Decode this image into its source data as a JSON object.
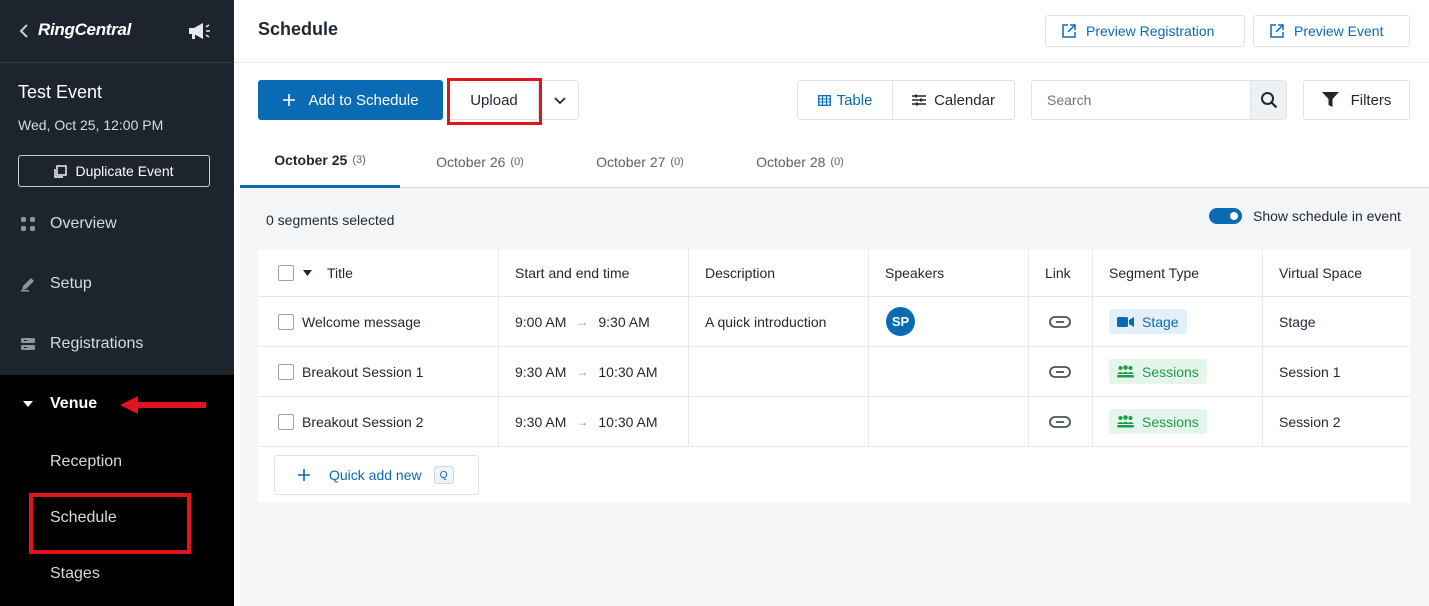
{
  "sidebar": {
    "brand": "RingCentral",
    "event_name": "Test Event",
    "event_date": "Wed, Oct 25, 12:00 PM",
    "duplicate_label": "Duplicate Event",
    "nav": [
      {
        "label": "Overview",
        "icon": "grid-icon"
      },
      {
        "label": "Setup",
        "icon": "pencil-icon"
      },
      {
        "label": "Registrations",
        "icon": "registrations-icon"
      }
    ],
    "venue_label": "Venue",
    "venue_items": [
      "Reception",
      "Schedule",
      "Stages"
    ]
  },
  "header": {
    "title": "Schedule",
    "preview_registration": "Preview Registration",
    "preview_event": "Preview Event"
  },
  "toolbar": {
    "add_label": "Add to Schedule",
    "upload_label": "Upload",
    "view_table": "Table",
    "view_calendar": "Calendar",
    "search_placeholder": "Search",
    "filters_label": "Filters"
  },
  "tabs": [
    {
      "label": "October 25",
      "count": "(3)",
      "active": true
    },
    {
      "label": "October 26",
      "count": "(0)",
      "active": false
    },
    {
      "label": "October 27",
      "count": "(0)",
      "active": false
    },
    {
      "label": "October 28",
      "count": "(0)",
      "active": false
    }
  ],
  "summary": {
    "selected": "0 segments selected",
    "toggle_label": "Show schedule in event",
    "toggle_on": true
  },
  "table": {
    "columns": [
      "Title",
      "Start and end time",
      "Description",
      "Speakers",
      "Link",
      "Segment Type",
      "Virtual Space"
    ],
    "rows": [
      {
        "title": "Welcome message",
        "start": "9:00 AM",
        "end": "9:30 AM",
        "description": "A quick introduction",
        "speaker": "SP",
        "segment_type": "Stage",
        "virtual_space": "Stage"
      },
      {
        "title": "Breakout Session 1",
        "start": "9:30 AM",
        "end": "10:30 AM",
        "description": "",
        "speaker": "",
        "segment_type": "Sessions",
        "virtual_space": "Session 1"
      },
      {
        "title": "Breakout Session 2",
        "start": "9:30 AM",
        "end": "10:30 AM",
        "description": "",
        "speaker": "",
        "segment_type": "Sessions",
        "virtual_space": "Session 2"
      }
    ],
    "quick_add_label": "Quick add new",
    "quick_add_shortcut": "Q"
  },
  "colors": {
    "sidebar": "#1d242e",
    "accent": "#0a6bb5",
    "annotation_red": "#e0141c",
    "sessions_green": "#1e9a4b"
  }
}
